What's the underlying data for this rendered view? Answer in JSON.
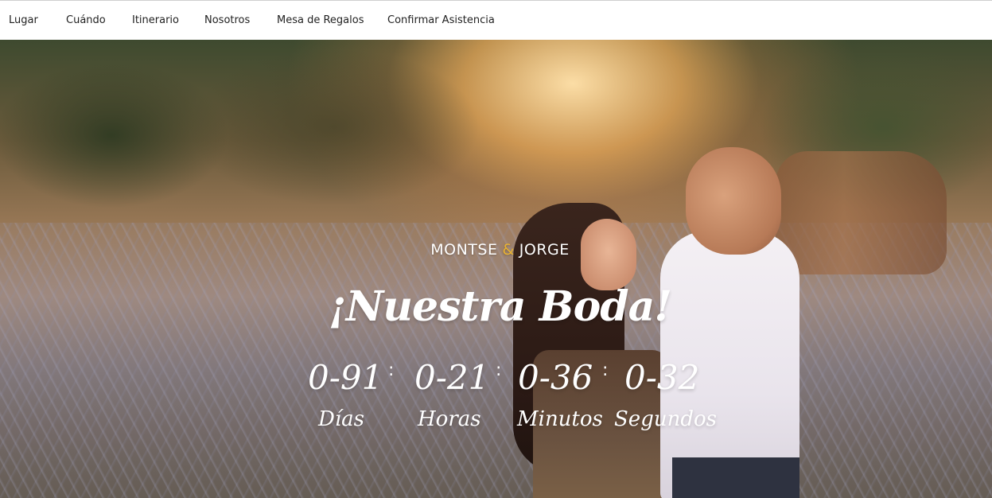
{
  "nav": {
    "items": [
      {
        "label": "Lugar"
      },
      {
        "label": "Cuándo"
      },
      {
        "label": "Itinerario"
      },
      {
        "label": "Nosotros"
      },
      {
        "label": "Mesa de Regalos"
      },
      {
        "label": "Confirmar Asistencia"
      }
    ]
  },
  "hero": {
    "name_1": "MONTSE",
    "ampersand": "&",
    "name_2": "JORGE",
    "title": "¡Nuestra Boda!",
    "countdown": {
      "separator": ":",
      "days_value": "0-91",
      "days_label": "Días",
      "hours_value": "0-21",
      "hours_label": "Horas",
      "minutes_value": "0-36",
      "minutes_label": "Minutos",
      "seconds_value": "0-32",
      "seconds_label": "Segundos"
    }
  },
  "colors": {
    "accent": "#e8b232",
    "text_on_hero": "#ffffff",
    "nav_text": "#1f1f1f"
  }
}
